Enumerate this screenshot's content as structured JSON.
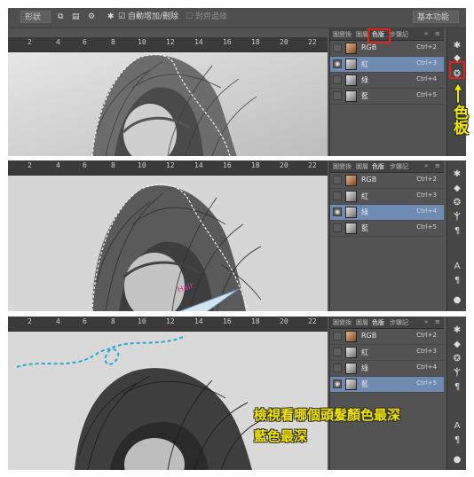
{
  "options_bar": {
    "btn_feather": "形狀",
    "auto_add_delete": "自動增加/刪除",
    "align_edges": "對齊邊緣",
    "workspace": "基本功能"
  },
  "ruler_ticks_top": [
    "2",
    "4",
    "6",
    "8",
    "10",
    "12",
    "14",
    "16",
    "18",
    "20",
    "22"
  ],
  "ruler_ticks": [
    "2",
    "4",
    "6",
    "8",
    "10",
    "12",
    "14",
    "16",
    "18",
    "20",
    "22"
  ],
  "tabs": [
    "圖變換",
    "圖層",
    "色版",
    "步驟記"
  ],
  "channels": [
    {
      "name": "RGB",
      "key": "Ctrl+2"
    },
    {
      "name": "紅",
      "key": "Ctrl+3"
    },
    {
      "name": "綠",
      "key": "Ctrl+4"
    },
    {
      "name": "藍",
      "key": "Ctrl+5"
    }
  ],
  "labels": {
    "channel_panel": "色板",
    "instruction_line1": "檢視看哪個頭髮顏色最深",
    "instruction_line2": "藍色最深",
    "handwritten": "Hair"
  },
  "colors": {
    "accent_yellow": "#f2e600",
    "highlight_red": "#e2231a",
    "selected_row": "#6f8bb2",
    "dash_blue": "#22a7d8",
    "magenta": "#e0369b"
  },
  "selected_channel_per_panel": [
    "紅",
    "綠",
    "藍"
  ]
}
